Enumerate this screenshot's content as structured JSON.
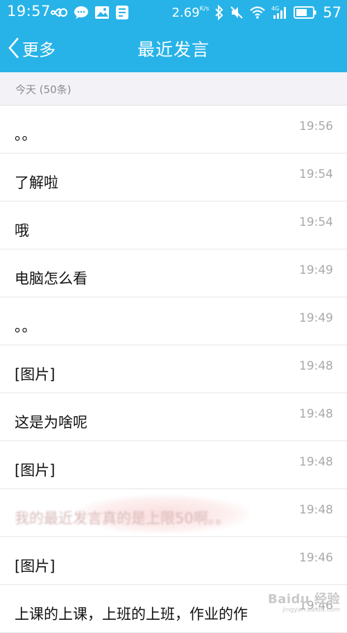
{
  "status_bar": {
    "time": "19:57",
    "speed": "2.69",
    "speed_unit": "K/s",
    "network": "4G",
    "battery": "57",
    "icons": [
      "infinity-icon",
      "wechat-icon",
      "gallery-icon",
      "app-icon",
      "bluetooth-icon",
      "mute-icon",
      "wifi-icon",
      "signal-icon",
      "battery-icon"
    ]
  },
  "nav": {
    "back_label": "更多",
    "title": "最近发言"
  },
  "section": {
    "label": "今天 (50条)"
  },
  "messages": [
    {
      "text": "。。",
      "time": "19:56"
    },
    {
      "text": "了解啦",
      "time": "19:54"
    },
    {
      "text": "哦",
      "time": "19:54"
    },
    {
      "text": "电脑怎么看",
      "time": "19:49"
    },
    {
      "text": "。。",
      "time": "19:49"
    },
    {
      "text": "[图片]",
      "time": "19:48"
    },
    {
      "text": "这是为啥呢",
      "time": "19:48"
    },
    {
      "text": "[图片]",
      "time": "19:48"
    },
    {
      "text": "我的最近发言真的是上限50啊。。",
      "time": "19:48"
    },
    {
      "text": "[图片]",
      "time": "19:46"
    },
    {
      "text": "上课的上课，上班的上班，作业的作",
      "time": "19:46"
    }
  ],
  "watermark": {
    "logo": "Baidu 经验",
    "url": "jingyan.baidu.com"
  },
  "colors": {
    "header": "#27b3e8",
    "section_bg": "#f3f2f7",
    "time_text": "#a9a9a9"
  }
}
